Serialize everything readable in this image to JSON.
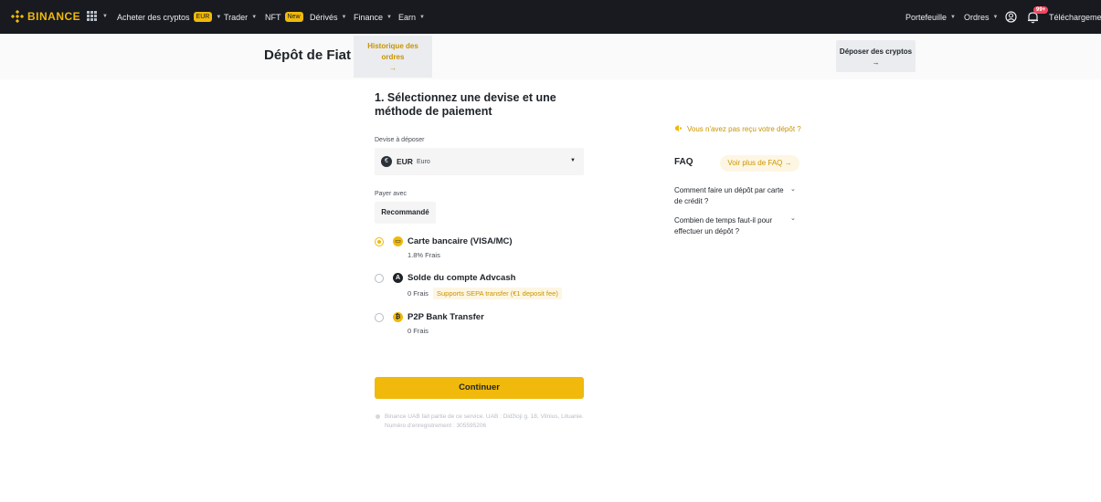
{
  "topbar": {
    "logo": "BINANCE",
    "nav": [
      {
        "label": "Acheter des cryptos",
        "badge": "EUR"
      },
      {
        "label": "Trader"
      },
      {
        "label": "NFT",
        "badge": "New"
      },
      {
        "label": "Dérivés"
      },
      {
        "label": "Finance"
      },
      {
        "label": "Earn"
      }
    ],
    "right": {
      "wallet": "Portefeuille",
      "orders": "Ordres",
      "notif_count": "99+",
      "download": "Téléchargement"
    }
  },
  "subheader": {
    "title": "Dépôt de Fiat",
    "history_line1": "Historique des",
    "history_line2": "ordres",
    "history_arrow": "→",
    "deposit_crypto": "Déposer des cryptos",
    "deposit_arrow": "→"
  },
  "form": {
    "step_title": "1. Sélectionnez une devise et une méthode de paiement",
    "currency_label": "Devise à déposer",
    "currency_code": "EUR",
    "currency_name": "Euro",
    "currency_symbol": "€",
    "pay_with_label": "Payer avec",
    "recommended": "Recommandé",
    "methods": [
      {
        "title": "Carte bancaire (VISA/MC)",
        "fee": "1.8% Frais",
        "tag": "",
        "selected": true,
        "icon": "credit-card-icon"
      },
      {
        "title": "Solde du compte Advcash",
        "fee": "0 Frais",
        "tag": "Supports SEPA transfer (€1 deposit fee)",
        "selected": false,
        "icon": "advcash-icon"
      },
      {
        "title": "P2P Bank Transfer",
        "fee": "0 Frais",
        "tag": "",
        "selected": false,
        "icon": "p2p-icon"
      }
    ],
    "continue": "Continuer",
    "legal": "Binance UAB fait partie de ce service. UAB : Didžioji g. 18, Vilnius, Lituanie. Numéro d'enregistrement : 305595206"
  },
  "side": {
    "not_received": "Vous n'avez pas reçu votre dépôt ?",
    "faq_title": "FAQ",
    "faq_more": "Voir plus de FAQ →",
    "questions": [
      "Comment faire un dépôt par carte de crédit ?",
      "Combien de temps faut-il pour effectuer un dépôt ?"
    ]
  },
  "colors": {
    "brand": "#f0b90b",
    "topbar": "#181a20",
    "link": "#c99400"
  }
}
